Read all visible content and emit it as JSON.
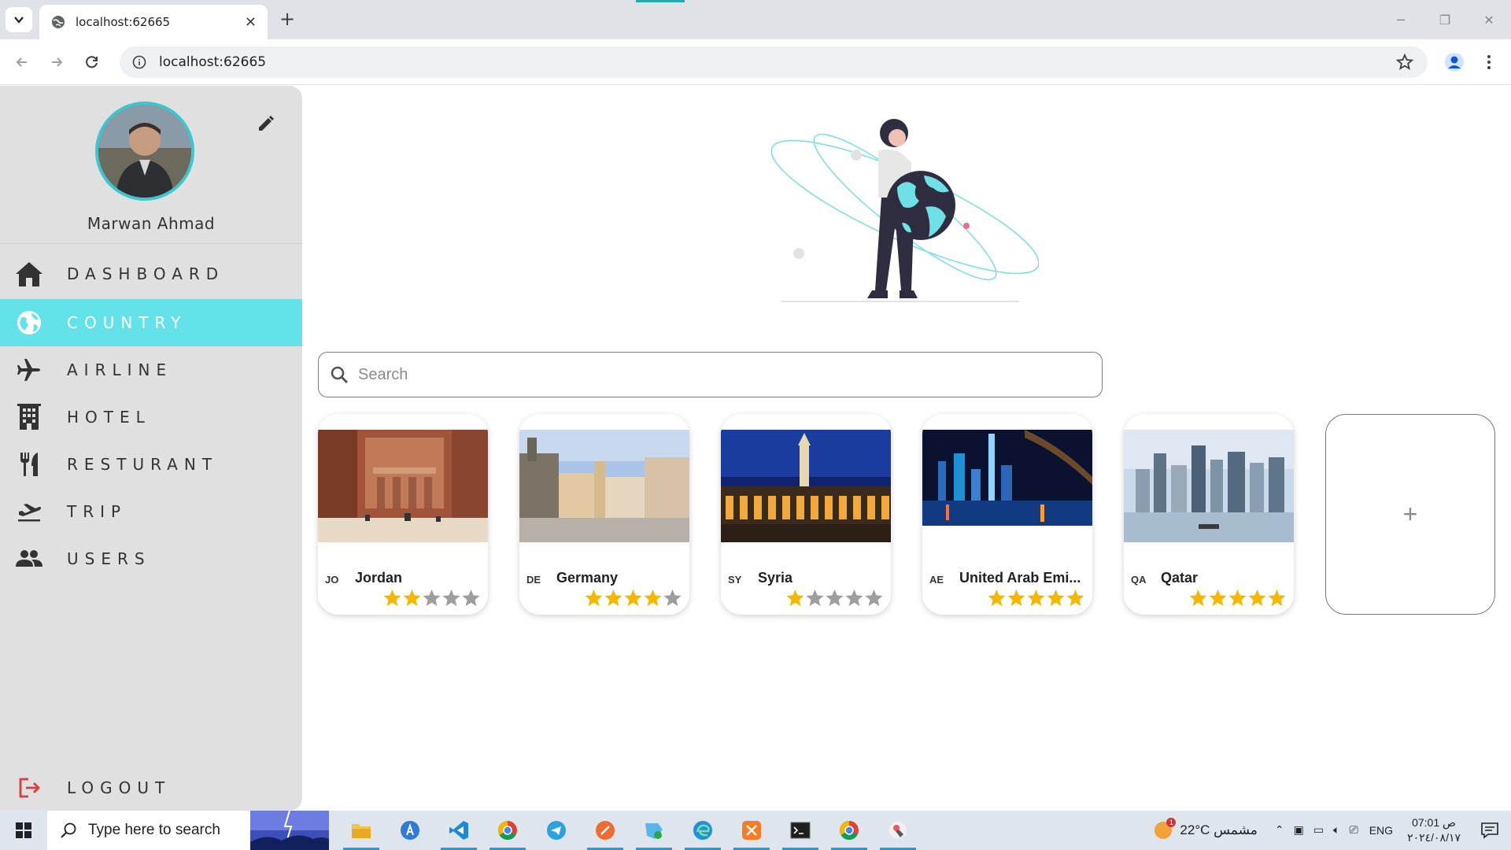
{
  "browser": {
    "tab_title": "localhost:62665",
    "url": "localhost:62665"
  },
  "user": {
    "name": "Marwan Ahmad"
  },
  "nav": {
    "items": [
      {
        "label": "DASHBOARD",
        "icon": "home-icon",
        "active": false
      },
      {
        "label": "COUNTRY",
        "icon": "globe-icon",
        "active": true
      },
      {
        "label": "AIRLINE",
        "icon": "airplane-icon",
        "active": false
      },
      {
        "label": "HOTEL",
        "icon": "building-icon",
        "active": false
      },
      {
        "label": "RESTURANT",
        "icon": "fork-knife-icon",
        "active": false
      },
      {
        "label": "TRIP",
        "icon": "flight-takeoff-icon",
        "active": false
      },
      {
        "label": "USERS",
        "icon": "users-icon",
        "active": false
      }
    ],
    "logout_label": "LOGOUT"
  },
  "search": {
    "placeholder": "Search"
  },
  "countries": [
    {
      "code": "JO",
      "name": "Jordan",
      "rating": 2
    },
    {
      "code": "DE",
      "name": "Germany",
      "rating": 4
    },
    {
      "code": "SY",
      "name": "Syria",
      "rating": 1
    },
    {
      "code": "AE",
      "name": "United Arab Emi...",
      "rating": 5
    },
    {
      "code": "QA",
      "name": "Qatar",
      "rating": 5
    }
  ],
  "add_card": {
    "label": "+"
  },
  "taskbar": {
    "search_placeholder": "Type here to search",
    "weather": "22°C  مشمس",
    "language": "ENG",
    "time": "07:01 ص",
    "date": "٢٠٢٤/٠٨/١٧"
  },
  "colors": {
    "accent": "#64e2e9",
    "star_on": "#f5b800",
    "star_off": "#9e9e9e",
    "logout": "#e03a3a"
  }
}
